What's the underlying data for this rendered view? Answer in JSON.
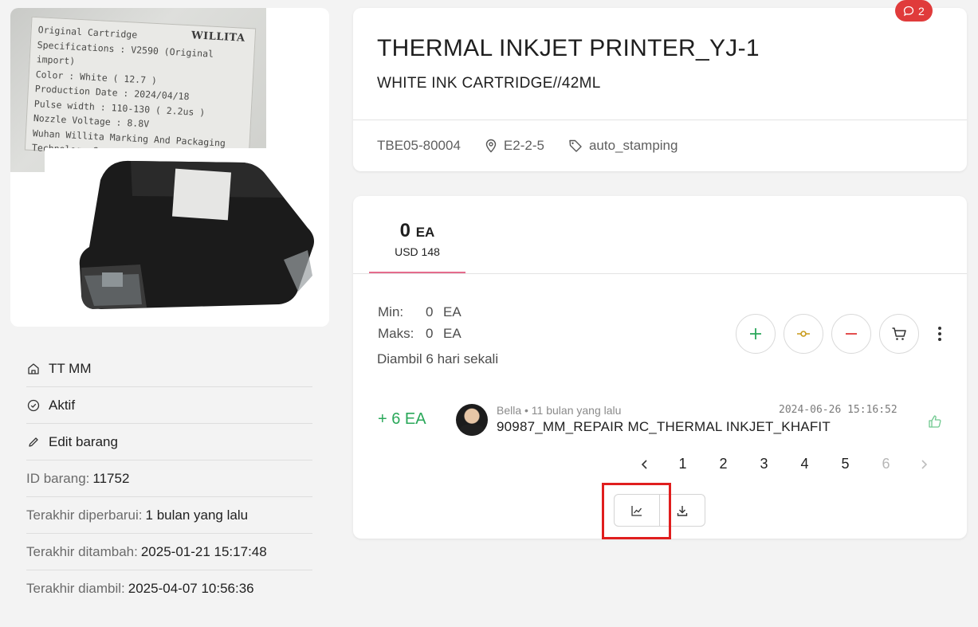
{
  "product": {
    "title": "THERMAL INKJET PRINTER_YJ-1",
    "subtitle": "WHITE INK CARTRIDGE//42ML",
    "code": "TBE05-80004",
    "location": "E2-2-5",
    "tag": "auto_stamping",
    "comment_count": "2"
  },
  "photo": {
    "label_brand": "WILLITA",
    "label_lines": [
      "Original Cartridge",
      "Specifications : V2590 (Original  import)",
      "Color : White  ( 12.7 )",
      "Production Date : 2024/04/18",
      "Pulse width : 110-130 ( 2.2us )",
      "Nozzle Voltage : 8.8V",
      "Wuhan Willita Marking And Packaging",
      "Technology Co., Ltd."
    ]
  },
  "sidebar": {
    "warehouse": "TT MM",
    "status": "Aktif",
    "edit_label": "Edit barang",
    "id_label": "ID barang:",
    "id_value": "11752",
    "updated_label": "Terakhir diperbarui:",
    "updated_value": "1 bulan yang lalu",
    "added_label": "Terakhir ditambah:",
    "added_value": "2025-01-21 15:17:48",
    "taken_label": "Terakhir diambil:",
    "taken_value": "2025-04-07 10:56:36"
  },
  "stock": {
    "qty": "0",
    "unit": "EA",
    "price": "USD 148",
    "min_label": "Min:",
    "min_value": "0",
    "max_label": "Maks:",
    "max_value": "0",
    "frequency": "Diambil 6 hari sekali"
  },
  "history": [
    {
      "delta": "+ 6 EA",
      "meta": "Bella • 11 bulan yang lalu",
      "timestamp": "2024-06-26 15:16:52",
      "description": "90987_MM_REPAIR MC_THERMAL INKJET_KHAFIT"
    }
  ],
  "pagination": {
    "pages": [
      "1",
      "2",
      "3",
      "4",
      "5",
      "6"
    ],
    "current": "6"
  },
  "colors": {
    "accent_tab": "#e46b8c",
    "positive": "#2aa85a",
    "negative": "#e03b3b",
    "adjust": "#c89a1a",
    "badge": "#e03b3b",
    "highlight": "#e01e1e"
  },
  "icons": {
    "warehouse": "home-icon",
    "status": "check-circle-icon",
    "edit": "pencil-icon",
    "location": "map-pin-icon",
    "tag": "tag-icon",
    "comment": "chat-bubble-icon",
    "add": "plus-icon",
    "adjust": "commit-icon",
    "remove": "minus-icon",
    "order": "cart-icon",
    "more": "more-vertical-icon",
    "like": "thumbs-up-icon",
    "prev": "chevron-left-icon",
    "next": "chevron-right-icon",
    "chart": "line-chart-icon",
    "download": "download-icon"
  }
}
